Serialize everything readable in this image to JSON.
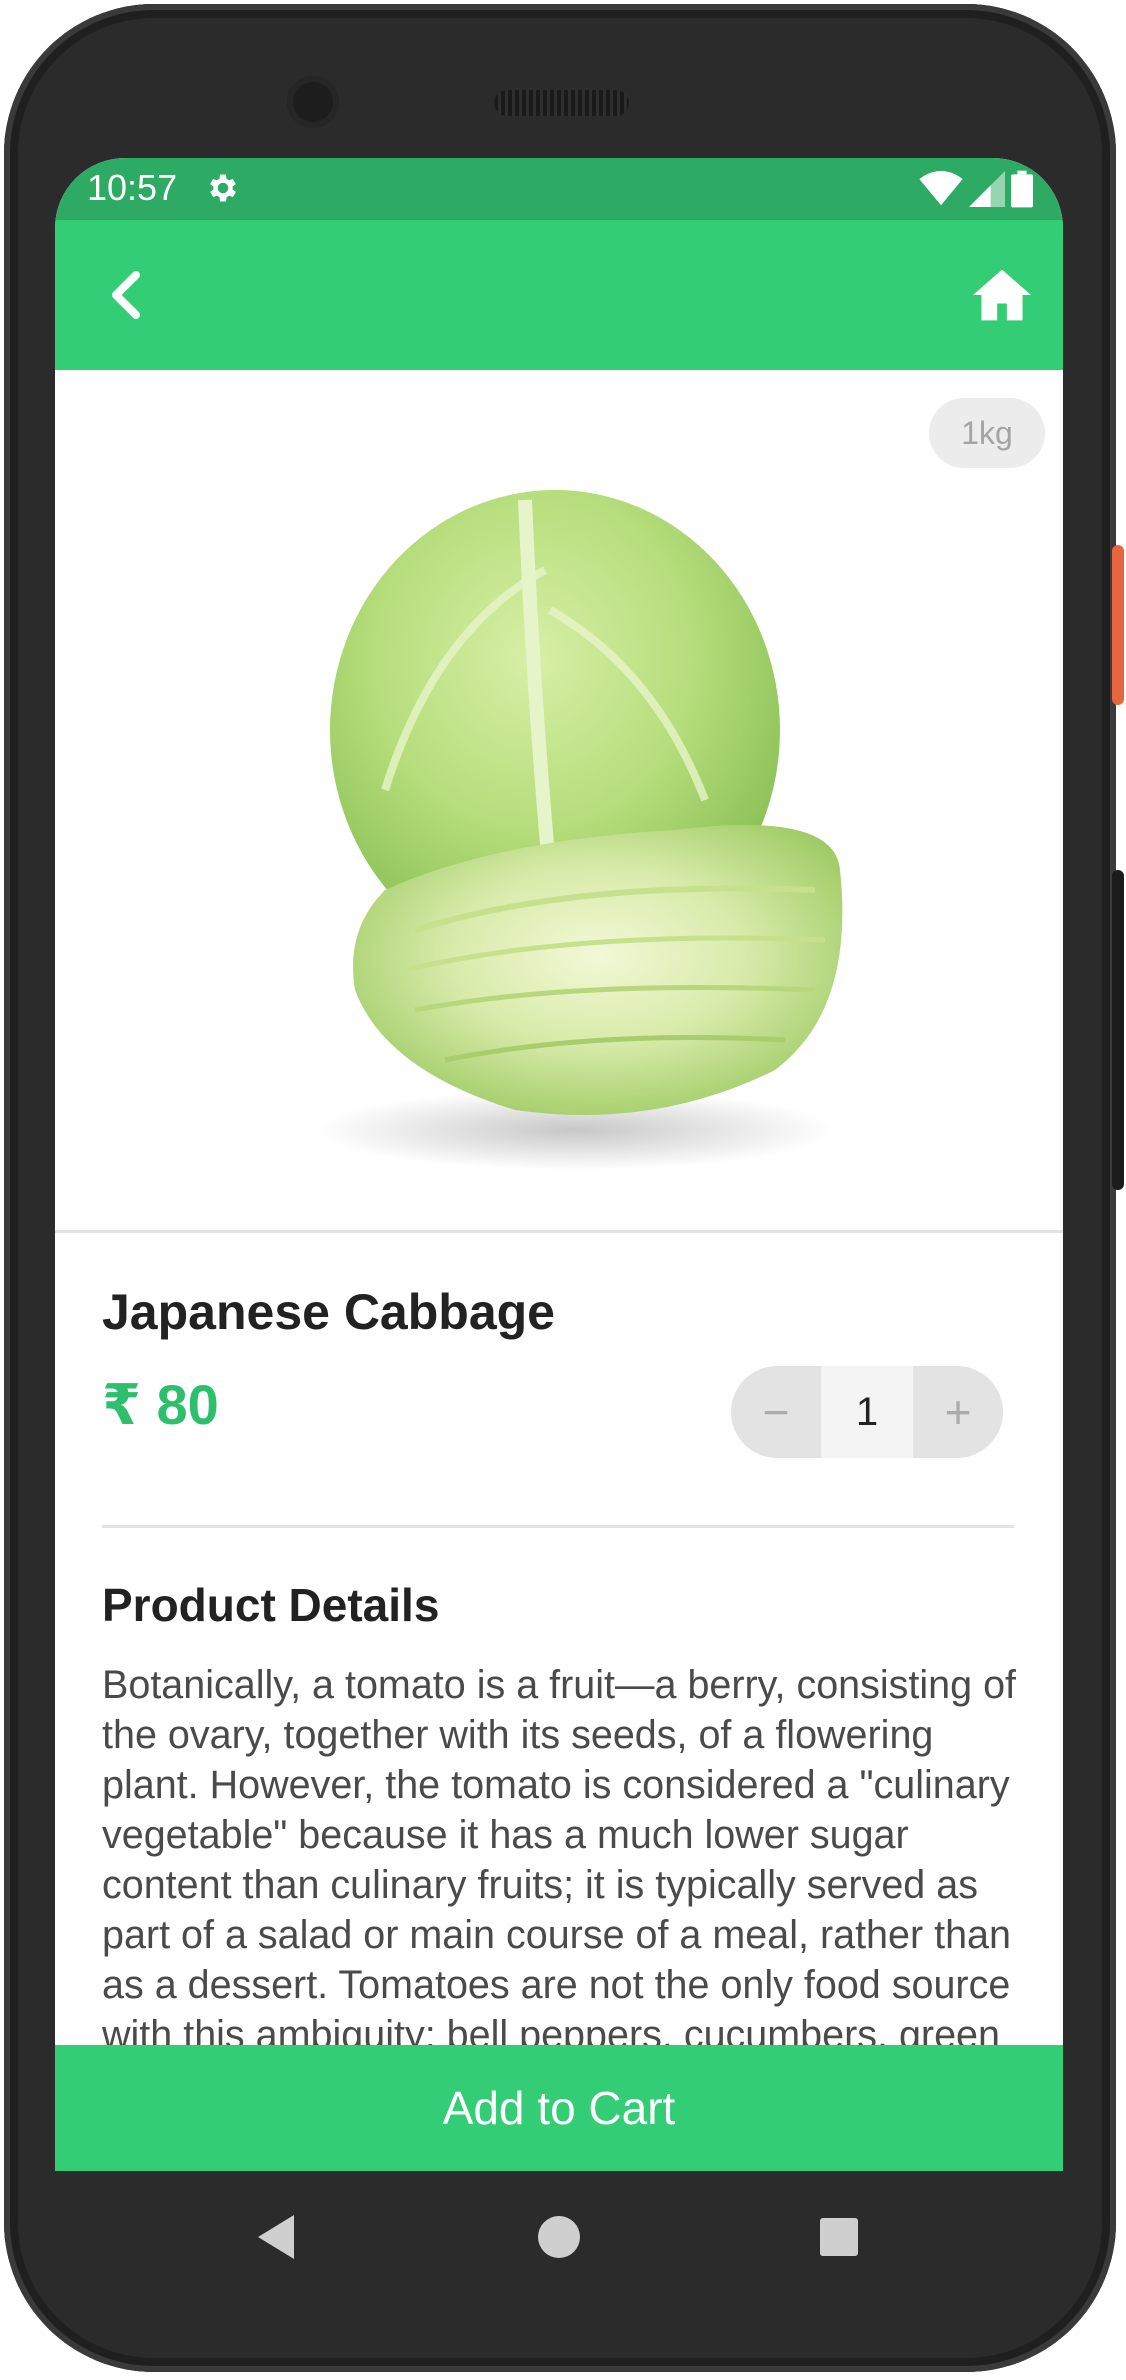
{
  "status_bar": {
    "time": "10:57",
    "background_color": "#2daa63"
  },
  "app_bar": {
    "background_color": "#32cd75",
    "back_icon": "chevron-left-icon",
    "home_icon": "home-icon"
  },
  "product": {
    "image_icon": "cabbage-image",
    "weight_badge": "1kg",
    "name": "Japanese Cabbage",
    "price": "₹ 80",
    "price_color": "#2ebf6d",
    "quantity": {
      "decrement_label": "−",
      "value": "1",
      "increment_label": "+"
    }
  },
  "details": {
    "heading": "Product Details",
    "text": "Botanically, a tomato is a fruit—a berry, consisting of the ovary, together with its seeds, of a flowering plant. However, the tomato is considered a \"culinary vegetable\" because it has a much lower sugar content than culinary fruits; it is typically served as part of a salad or main course of a meal, rather than as a dessert. Tomatoes are not the only food source with this ambiguity; bell peppers, cucumbers, green beans, eggplants, avocados, and squashes of all kinds (such as zucchini and pumpkins) are all botanically fruit, yet cooked as vegetables."
  },
  "cta": {
    "label": "Add to Cart",
    "background_color": "#32cd75"
  },
  "system_nav": {
    "back_icon": "triangle-back-icon",
    "home_icon": "circle-home-icon",
    "recents_icon": "square-recents-icon"
  }
}
